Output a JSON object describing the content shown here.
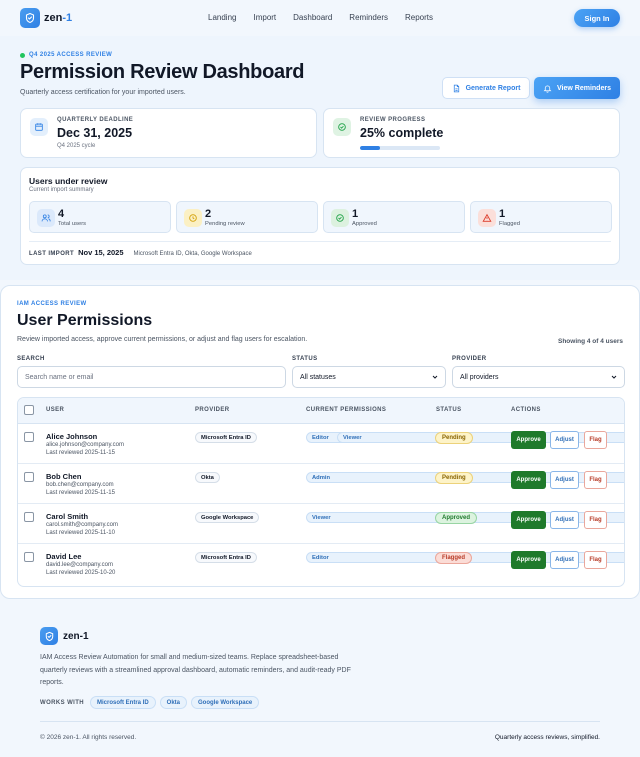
{
  "brand": {
    "name_prefix": "zen",
    "name_suffix": "-1",
    "full_name": "zen-1"
  },
  "nav": {
    "links": [
      "Landing",
      "Import",
      "Dashboard",
      "Reminders",
      "Reports"
    ],
    "signin": "Sign In"
  },
  "hero": {
    "eyebrow": "Q4 2025 ACCESS REVIEW",
    "title": "Permission Review Dashboard",
    "subtitle": "Quarterly access certification for your imported users.",
    "generate_report": "Generate Report",
    "view_reminders": "View Reminders"
  },
  "deadline": {
    "label": "QUARTERLY DEADLINE",
    "value": "Dec 31, 2025",
    "sub": "Q4 2025 cycle"
  },
  "progress": {
    "label": "REVIEW PROGRESS",
    "value": "25% complete",
    "percent": 25
  },
  "users_review": {
    "title": "Users under review",
    "subtitle": "Current import summary",
    "stats": [
      {
        "num": "4",
        "label": "Total users",
        "icon": "users-icon",
        "color": "#2f80e4"
      },
      {
        "num": "2",
        "label": "Pending review",
        "icon": "clock-icon",
        "color": "#d4a20b"
      },
      {
        "num": "1",
        "label": "Approved",
        "icon": "check-circle-icon",
        "color": "#22a34a"
      },
      {
        "num": "1",
        "label": "Flagged",
        "icon": "warning-icon",
        "color": "#dc3b2a"
      }
    ],
    "last_import_label": "LAST IMPORT",
    "last_import_date": "Nov 15, 2025",
    "last_import_sources": "Microsoft Entra ID, Okta, Google Workspace"
  },
  "permissions": {
    "eyebrow": "IAM ACCESS REVIEW",
    "title": "User Permissions",
    "subtitle": "Review imported access, approve current permissions, or adjust and flag users for escalation.",
    "showing": "Showing 4 of 4 users",
    "filters": {
      "search_label": "SEARCH",
      "search_placeholder": "Search name or email",
      "status_label": "STATUS",
      "status_value": "All statuses",
      "provider_label": "PROVIDER",
      "provider_value": "All providers"
    },
    "columns": [
      "USER",
      "PROVIDER",
      "CURRENT PERMISSIONS",
      "STATUS",
      "ACTIONS"
    ],
    "actions": {
      "approve": "Approve",
      "adjust": "Adjust",
      "flag": "Flag"
    },
    "rows": [
      {
        "name": "Alice Johnson",
        "email": "alice.johnson@company.com",
        "reviewed": "Last reviewed 2025-11-15",
        "provider": "Microsoft Entra ID",
        "permissions": [
          "Editor",
          "Viewer"
        ],
        "status": "Pending"
      },
      {
        "name": "Bob Chen",
        "email": "bob.chen@company.com",
        "reviewed": "Last reviewed 2025-11-15",
        "provider": "Okta",
        "permissions": [
          "Admin"
        ],
        "status": "Pending"
      },
      {
        "name": "Carol Smith",
        "email": "carol.smith@company.com",
        "reviewed": "Last reviewed 2025-11-10",
        "provider": "Google Workspace",
        "permissions": [
          "Viewer"
        ],
        "status": "Approved"
      },
      {
        "name": "David Lee",
        "email": "david.lee@company.com",
        "reviewed": "Last reviewed 2025-10-20",
        "provider": "Microsoft Entra ID",
        "permissions": [
          "Editor"
        ],
        "status": "Flagged"
      }
    ],
    "status_colors": {
      "Pending": {
        "bg": "#fdf3c8",
        "border": "#ecd27a",
        "fg": "#8a6400"
      },
      "Approved": {
        "bg": "#dcf3df",
        "border": "#98d5a3",
        "fg": "#1f7a2b"
      },
      "Flagged": {
        "bg": "#fbdcd6",
        "border": "#eba79b",
        "fg": "#b83b27"
      }
    }
  },
  "footer": {
    "name": "zen-1",
    "description": "IAM Access Review Automation for small and medium-sized teams. Replace spreadsheet-based quarterly reviews with a streamlined approval dashboard, automatic reminders, and audit-ready PDF reports.",
    "works_with_label": "WORKS WITH",
    "works_with": [
      "Microsoft Entra ID",
      "Okta",
      "Google Workspace"
    ],
    "copyright": "© 2026 zen-1. All rights reserved.",
    "tagline": "Quarterly access reviews, simplified."
  }
}
